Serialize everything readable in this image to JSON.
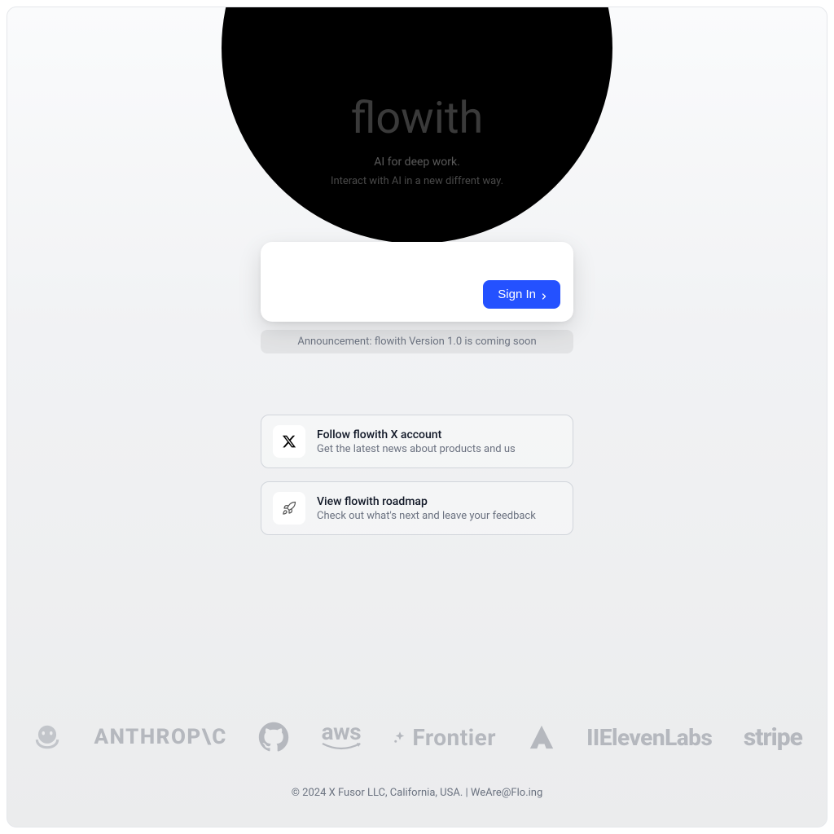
{
  "hero": {
    "title": "flowith",
    "subtitle1": "AI for deep work.",
    "subtitle2": "Interact with AI in a new diffrent way."
  },
  "auth": {
    "sign_in_label": "Sign In"
  },
  "announcement": {
    "text": "Announcement: flowith Version 1.0 is coming soon"
  },
  "cards": [
    {
      "icon": "x-icon",
      "title": "Follow flowith X account",
      "subtitle": "Get the latest news about products and us"
    },
    {
      "icon": "rocket-icon",
      "title": "View flowith roadmap",
      "subtitle": "Check out what's next and leave your feedback"
    }
  ],
  "logos": [
    {
      "name": "octocat-icon",
      "label": ""
    },
    {
      "name": "anthropic",
      "label": "ANTHROP\\C"
    },
    {
      "name": "github-icon",
      "label": ""
    },
    {
      "name": "aws",
      "label": "aws"
    },
    {
      "name": "frontier",
      "label": "Frontier"
    },
    {
      "name": "a-block-icon",
      "label": ""
    },
    {
      "name": "elevenlabs",
      "label": "IIElevenLabs"
    },
    {
      "name": "stripe",
      "label": "stripe"
    }
  ],
  "footer": {
    "text": "© 2024 X Fusor LLC, California, USA. | WeAre@Flo.ing"
  }
}
